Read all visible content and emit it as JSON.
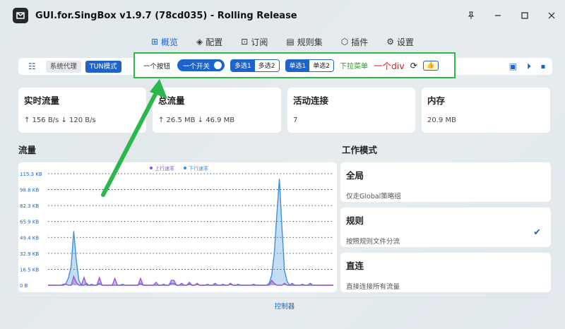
{
  "window": {
    "title": "GUI.for.SingBox v1.9.7 (78cd035) - Rolling Release"
  },
  "nav": [
    {
      "label": "概览",
      "icon": "grid-icon",
      "active": true
    },
    {
      "label": "配置",
      "icon": "layers-icon",
      "active": false
    },
    {
      "label": "订阅",
      "icon": "plus-box-icon",
      "active": false
    },
    {
      "label": "规则集",
      "icon": "file-icon",
      "active": false
    },
    {
      "label": "插件",
      "icon": "cube-icon",
      "active": false
    },
    {
      "label": "设置",
      "icon": "gear-icon",
      "active": false
    }
  ],
  "toolbar": {
    "system_proxy": "系统代理",
    "tun_mode": "TUN模式",
    "a_button": "一个按钮",
    "a_switch": "一个开关",
    "multi1": "多选1",
    "multi2": "多选2",
    "single1": "单选1",
    "single2": "单选2",
    "dropdown": "下拉菜单",
    "a_div": "一个div",
    "thumb": "👍"
  },
  "cards": {
    "realtime": {
      "title": "实时流量",
      "value": "↑ 156 B/s ↓ 120 B/s"
    },
    "total": {
      "title": "总流量",
      "value": "↑ 26.5 MB ↓ 46.9 MB"
    },
    "active": {
      "title": "活动连接",
      "value": "7"
    },
    "memory": {
      "title": "内存",
      "value": "20.9 MB"
    }
  },
  "traffic": {
    "title": "流量"
  },
  "work_mode": {
    "title": "工作模式",
    "modes": [
      {
        "title": "全局",
        "desc": "仅走Global策略组",
        "selected": false
      },
      {
        "title": "规则",
        "desc": "按照规则文件分流",
        "selected": true
      },
      {
        "title": "直连",
        "desc": "直接连接所有流量",
        "selected": false
      }
    ]
  },
  "console": {
    "label": "控制器"
  },
  "colors": {
    "accent": "#1e63c9",
    "highlight": "#2bb74b",
    "up": "#9b59d6",
    "down": "#3f8fd8"
  },
  "chart_data": {
    "type": "area",
    "y_ticks": [
      "115.3 KB",
      "98.8 KB",
      "82.3 KB",
      "65.9 KB",
      "49.4 KB",
      "32.9 KB",
      "16.5 KB",
      "0 B"
    ],
    "ylim": [
      0,
      115.3
    ],
    "yunit": "KB",
    "legend_position": "top",
    "series": [
      {
        "name": "上行速率",
        "color": "#9b59d6",
        "values": [
          0,
          0,
          0,
          0,
          0,
          0,
          1,
          1,
          0,
          0,
          9,
          3,
          0,
          0,
          8,
          0,
          0,
          1,
          0,
          0,
          8,
          0,
          0,
          0,
          0,
          0,
          7,
          0,
          0,
          0,
          0,
          0,
          0,
          0,
          0,
          0,
          7,
          0,
          0,
          0,
          0,
          0,
          3,
          0,
          0,
          1,
          0,
          0,
          5,
          5,
          0,
          0,
          2,
          0,
          0,
          3,
          0,
          0,
          2,
          0,
          0,
          0,
          1,
          0,
          0,
          2,
          0,
          0,
          1,
          0,
          0,
          2,
          0,
          0,
          1,
          0,
          0,
          0,
          0,
          0,
          1,
          0,
          0,
          0,
          0,
          0,
          0,
          5,
          2,
          0,
          0,
          0,
          2,
          0,
          0,
          2,
          0,
          0,
          0,
          1,
          0,
          0,
          2,
          0,
          0,
          0,
          0,
          0,
          0,
          0,
          0,
          0
        ]
      },
      {
        "name": "下行速率",
        "color": "#3f8fd8",
        "values": [
          0,
          0,
          0,
          0,
          0,
          0,
          0,
          2,
          8,
          20,
          56,
          26,
          5,
          0,
          0,
          2,
          0,
          0,
          0,
          0,
          2,
          0,
          0,
          0,
          0,
          0,
          0,
          0,
          0,
          1,
          0,
          0,
          0,
          0,
          0,
          0,
          2,
          0,
          0,
          0,
          0,
          0,
          0,
          0,
          0,
          0,
          0,
          0,
          2,
          2,
          0,
          0,
          0,
          0,
          0,
          1,
          0,
          0,
          1,
          0,
          0,
          0,
          0,
          0,
          0,
          0,
          0,
          0,
          0,
          0,
          0,
          1,
          0,
          0,
          0,
          0,
          0,
          0,
          0,
          0,
          0,
          0,
          0,
          0,
          0,
          0,
          2,
          10,
          32,
          72,
          110,
          60,
          15,
          4,
          0,
          0,
          0,
          0,
          0,
          0,
          0,
          0,
          0,
          0,
          0,
          0,
          0,
          0,
          0,
          0,
          0,
          0
        ]
      }
    ]
  }
}
